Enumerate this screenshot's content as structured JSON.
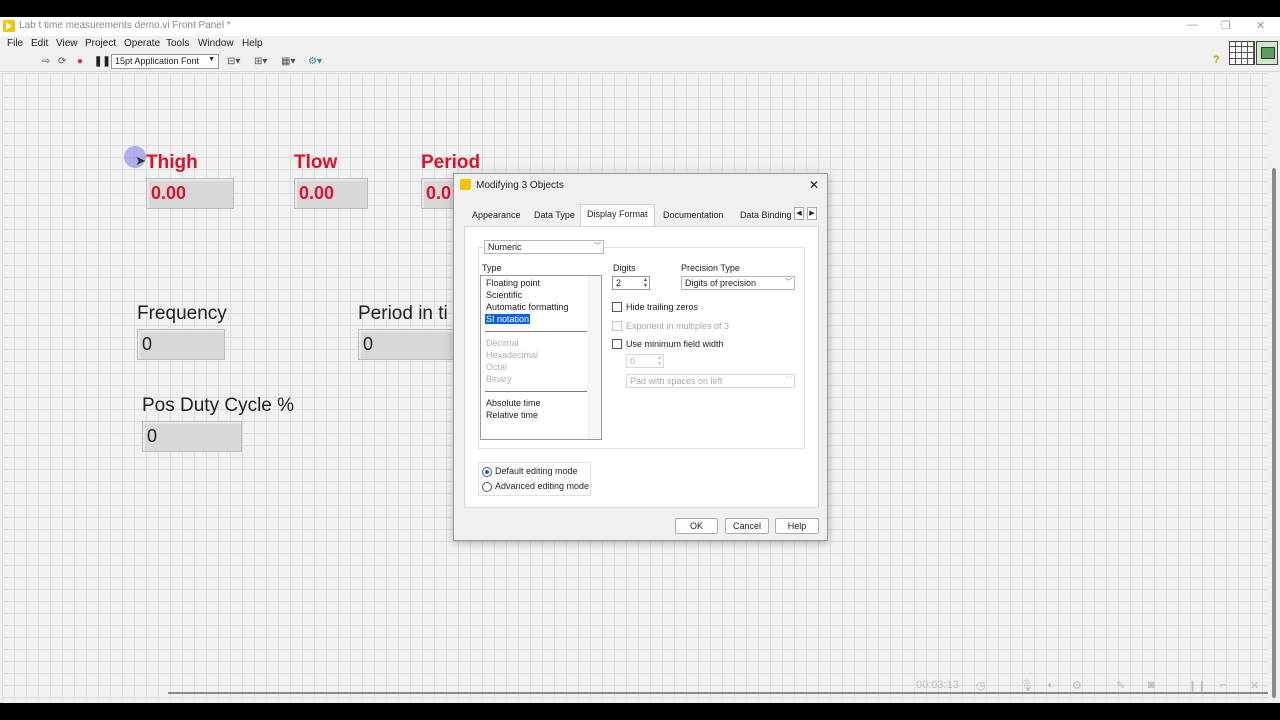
{
  "window": {
    "title": "Lab t time measurements demo.vi Front Panel *",
    "min": "—",
    "max": "❐",
    "close": "✕"
  },
  "menu": [
    "File",
    "Edit",
    "View",
    "Project",
    "Operate",
    "Tools",
    "Window",
    "Help"
  ],
  "toolbar": {
    "font": "15pt Application Font",
    "help": "?"
  },
  "panel": {
    "thigh": {
      "label": "Thigh",
      "value": "0.00"
    },
    "tlow": {
      "label": "Tlow",
      "value": "0.00"
    },
    "period": {
      "label": "Period",
      "value": "0.0"
    },
    "frequency": {
      "label": "Frequency",
      "value": "0"
    },
    "period_ti": {
      "label": "Period in ti",
      "value": "0"
    },
    "duty": {
      "label": "Pos Duty Cycle %",
      "value": "0"
    }
  },
  "dialog": {
    "title": "Modifying 3 Objects",
    "tabs": [
      "Appearance",
      "Data Type",
      "Display Format",
      "Documentation",
      "Data Binding"
    ],
    "active_tab": "Display Format",
    "format_combo": "Numeric",
    "type_label": "Type",
    "type_items": [
      "Floating point",
      "Scientific",
      "Automatic formatting",
      "SI notation"
    ],
    "type_selected": "SI notation",
    "int_items": [
      "Decimal",
      "Hexadecimal",
      "Octal",
      "Binary"
    ],
    "time_items": [
      "Absolute time",
      "Relative time"
    ],
    "digits_label": "Digits",
    "digits_value": "2",
    "precision_label": "Precision Type",
    "precision_value": "Digits of precision",
    "hide_zeros": "Hide trailing zeros",
    "exponent": "Exponent in multiples of 3",
    "min_width": "Use minimum field width",
    "min_width_value": "0",
    "pad_value": "Pad with spaces on left",
    "default_mode": "Default editing mode",
    "advanced_mode": "Advanced editing mode",
    "ok": "OK",
    "cancel": "Cancel",
    "help": "Help"
  },
  "player": {
    "time": "00:03:13"
  },
  "colors": {
    "label_red": "#e0102a",
    "selection": "#0a64d6",
    "labview_yellow": "#f5c400"
  }
}
